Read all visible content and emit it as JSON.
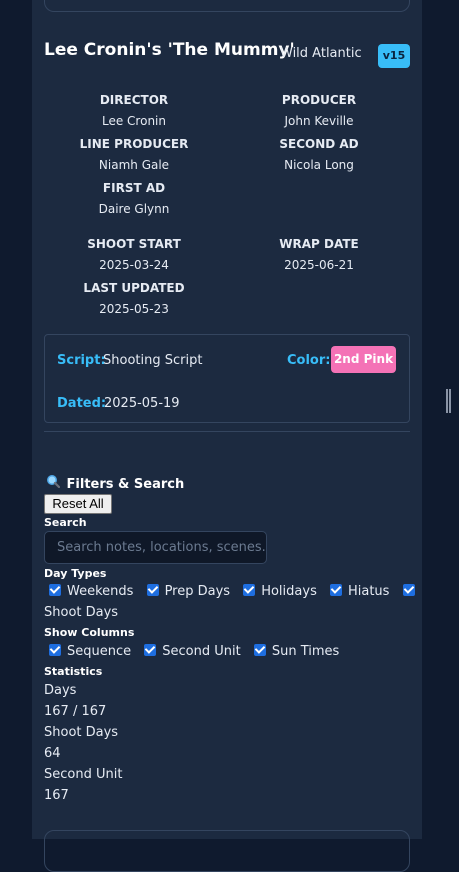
{
  "production": {
    "title": "Lee Cronin's 'The Mummy'",
    "studio": "Wild Atlantic",
    "version": "v15"
  },
  "crew": [
    {
      "label": "DIRECTOR",
      "value": "Lee Cronin"
    },
    {
      "label": "PRODUCER",
      "value": "John Keville"
    },
    {
      "label": "LINE PRODUCER",
      "value": "Niamh Gale"
    },
    {
      "label": "SECOND AD",
      "value": "Nicola Long"
    },
    {
      "label": "FIRST AD",
      "value": "Daire Glynn"
    }
  ],
  "dates": [
    {
      "label": "SHOOT START",
      "value": "2025-03-24"
    },
    {
      "label": "WRAP DATE",
      "value": "2025-06-21"
    },
    {
      "label": "LAST UPDATED",
      "value": "2025-05-23"
    }
  ],
  "script": {
    "script_label": "Script:",
    "script_value": "Shooting Script",
    "color_label": "Color:",
    "color_value": "2nd Pink",
    "dated_label": "Dated:",
    "dated_value": "2025-05-19",
    "color_hex": "#f472b6"
  },
  "filters": {
    "title": "Filters & Search",
    "icon": "magnifier-icon",
    "reset_label": "Reset All",
    "search_label": "Search",
    "search_placeholder": "Search notes, locations, scenes...",
    "day_types_label": "Day Types",
    "day_types": [
      "Weekends",
      "Prep Days",
      "Holidays",
      "Hiatus",
      "Shoot Days"
    ],
    "show_columns_label": "Show Columns",
    "columns": [
      "Sequence",
      "Second Unit",
      "Sun Times"
    ],
    "statistics_label": "Statistics",
    "stats": [
      {
        "label": "Days",
        "value": "167 / 167"
      },
      {
        "label": "Shoot Days",
        "value": "64"
      },
      {
        "label": "Second Unit",
        "value": "167"
      }
    ]
  },
  "colors": {
    "accent": "#38bdf8",
    "panel": "#1c2a40",
    "background": "#0f1a2e",
    "checkbox": "#1e6ee0"
  }
}
